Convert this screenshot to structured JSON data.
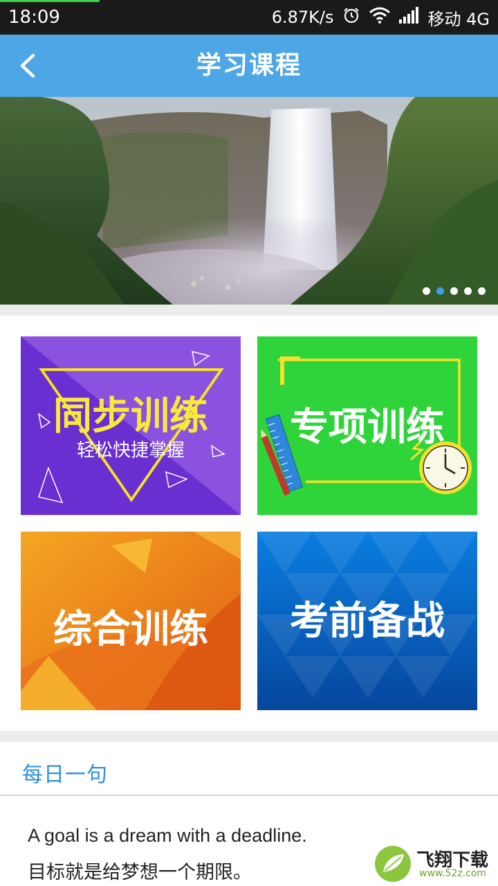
{
  "status_bar": {
    "time": "18:09",
    "net_speed": "6.87K/s",
    "carrier": "移动 4G",
    "icons": [
      "alarm-icon",
      "wifi-icon",
      "signal-icon"
    ],
    "load_progress": 0.2
  },
  "app_bar": {
    "title": "学习课程",
    "back_icon": "chevron-left-icon",
    "color": "#4da6e6"
  },
  "banner": {
    "image": "waterfall-landscape",
    "page_count": 5,
    "active_index": 1
  },
  "tiles": [
    {
      "title": "同步训练",
      "subtitle": "轻松快捷掌握",
      "color": "#7a3fd6"
    },
    {
      "title": "专项训练",
      "color": "#2fd43a"
    },
    {
      "title": "综合训练",
      "color": "#f08a1c"
    },
    {
      "title": "考前备战",
      "color": "#0a64c8"
    }
  ],
  "daily": {
    "heading": "每日一句",
    "quote_en": "A goal is a dream with a deadline.",
    "quote_zh": "目标就是给梦想一个期限。"
  },
  "watermark": {
    "name": "飞翔下载",
    "url": "www.52z.com"
  }
}
